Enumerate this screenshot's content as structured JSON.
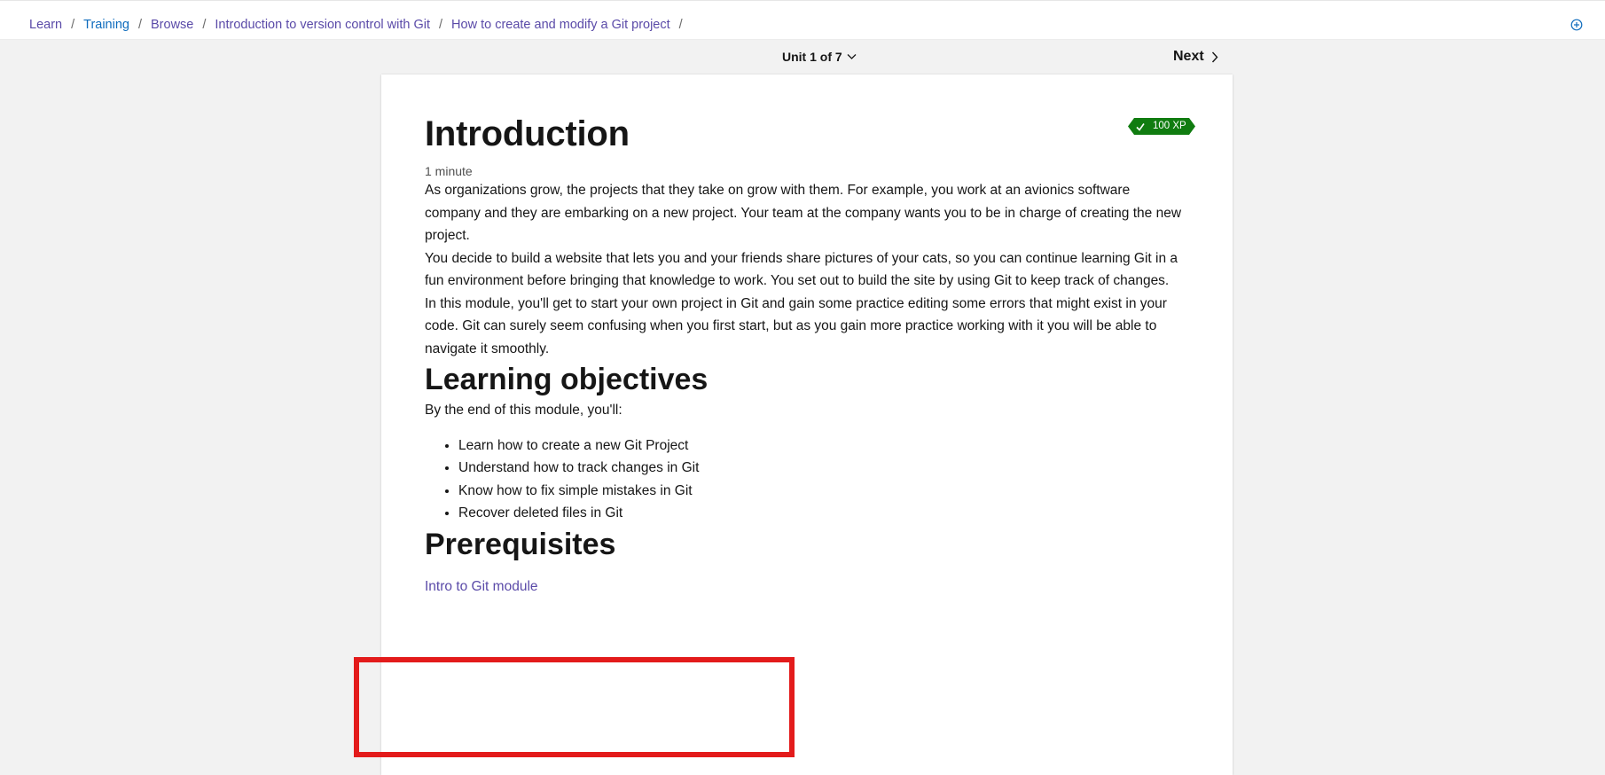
{
  "breadcrumb": {
    "items": [
      {
        "label": "Learn"
      },
      {
        "label": "Training"
      },
      {
        "label": "Browse"
      },
      {
        "label": "Introduction to version control with Git"
      },
      {
        "label": "How to create and modify a Git project"
      }
    ],
    "separator": "/"
  },
  "nav": {
    "unit_label": "Unit 1 of 7",
    "next_label": "Next"
  },
  "badge": {
    "xp_label": "100 XP",
    "color": "#107c10"
  },
  "content": {
    "title": "Introduction",
    "duration": "1 minute",
    "paragraphs": [
      "As organizations grow, the projects that they take on grow with them. For example, you work at an avionics software company and they are embarking on a new project. Your team at the company wants you to be in charge of creating the new project.",
      "You decide to build a website that lets you and your friends share pictures of your cats, so you can continue learning Git in a fun environment before bringing that knowledge to work. You set out to build the site by using Git to keep track of changes.",
      "In this module, you'll get to start your own project in Git and gain some practice editing some errors that might exist in your code. Git can surely seem confusing when you first start, but as you gain more practice working with it you will be able to navigate it smoothly."
    ],
    "objectives_heading": "Learning objectives",
    "objectives_intro": "By the end of this module, you'll:",
    "objectives": [
      "Learn how to create a new Git Project",
      "Understand how to track changes in Git",
      "Know how to fix simple mistakes in Git",
      "Recover deleted files in Git"
    ],
    "prereq_heading": "Prerequisites",
    "prereq_link": "Intro to Git module"
  },
  "colors": {
    "link": "#5a4aa8",
    "highlight_border": "#e31b1b",
    "background": "#f2f2f2"
  },
  "icons": {
    "add": "add-circle-icon",
    "unit_chevron": "chevron-down-icon",
    "next_chevron": "chevron-right-icon",
    "xp_check": "checkmark-icon"
  }
}
